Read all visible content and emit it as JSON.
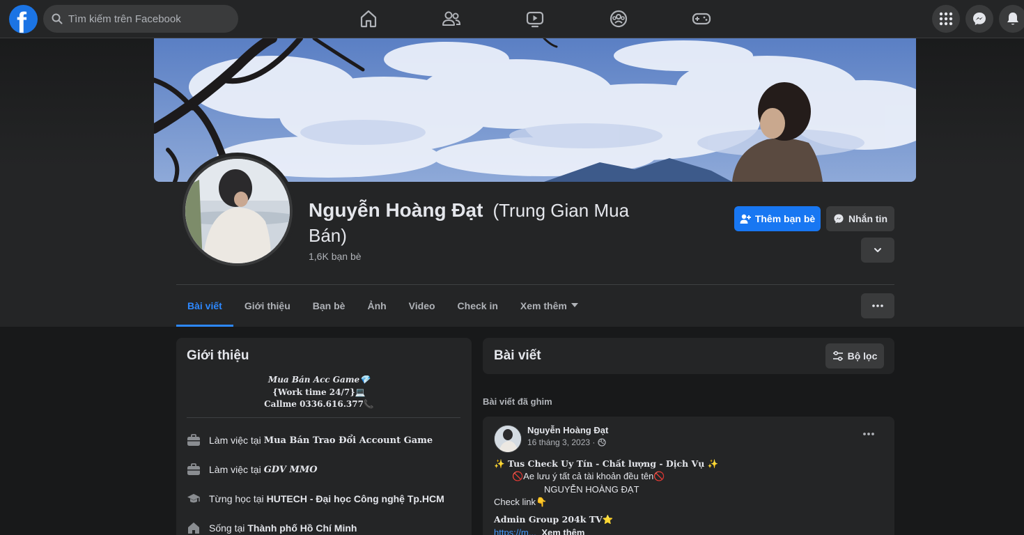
{
  "topbar": {
    "logo_letter": "f",
    "search_placeholder": "Tìm kiếm trên Facebook",
    "nav_icons": [
      "home-icon",
      "friends-icon",
      "watch-icon",
      "groups-icon",
      "gaming-icon"
    ],
    "right_icons": [
      "menu-grid-icon",
      "messenger-icon",
      "notifications-icon"
    ]
  },
  "profile": {
    "name": "Nguyễn Hoàng Đạt",
    "alt_name": "(Trung Gian Mua Bán)",
    "friends": "1,6K bạn bè",
    "add_friend_label": "Thêm bạn bè",
    "message_label": "Nhắn tin"
  },
  "tabs": [
    {
      "label": "Bài viết",
      "active": true
    },
    {
      "label": "Giới thiệu"
    },
    {
      "label": "Bạn bè"
    },
    {
      "label": "Ảnh"
    },
    {
      "label": "Video"
    },
    {
      "label": "Check in"
    },
    {
      "label": "Xem thêm"
    }
  ],
  "intro": {
    "title": "Giới thiệu",
    "bio_lines": [
      "Mua Bán Acc Game💎",
      "{Work time 24/7}💻",
      "Callme 0336.616.377📞"
    ],
    "items": [
      {
        "icon": "briefcase-icon",
        "prefix": "Làm việc tại",
        "value": "Mua Bán Trao Đổi Account Game"
      },
      {
        "icon": "briefcase-icon",
        "prefix": "Làm việc tại",
        "value": "GDV MMO"
      },
      {
        "icon": "graduation-cap-icon",
        "prefix": "Từng học tại",
        "value": "HUTECH - Đại học Công nghệ Tp.HCM"
      },
      {
        "icon": "home-icon",
        "prefix": "Sống tại",
        "value": "Thành phố Hồ Chí Minh"
      }
    ]
  },
  "posts": {
    "title": "Bài viết",
    "filter_label": "Bộ lọc",
    "pinned_label": "Bài viết đã ghim",
    "pinned_post": {
      "author": "Nguyễn Hoàng Đạt",
      "date": "16 tháng 3, 2023 ·",
      "lines": [
        "✨ Tus Check Uy Tín - Chất lượng - Dịch Vụ ✨",
        "🚫Ae lưu ý tất cả tài khoản đều tên🚫",
        "NGUYỄN HOÀNG ĐẠT",
        "Check link👇",
        "Admin Group 204k TV⭐"
      ],
      "link_text": "https://m...",
      "see_more": "Xem thêm"
    }
  },
  "colors": {
    "background": "#18191a",
    "surface": "#242526",
    "accent": "#1877f2",
    "tab_active": "#2d88ff",
    "text": "#e4e6eb",
    "muted": "#b0b3b8"
  }
}
